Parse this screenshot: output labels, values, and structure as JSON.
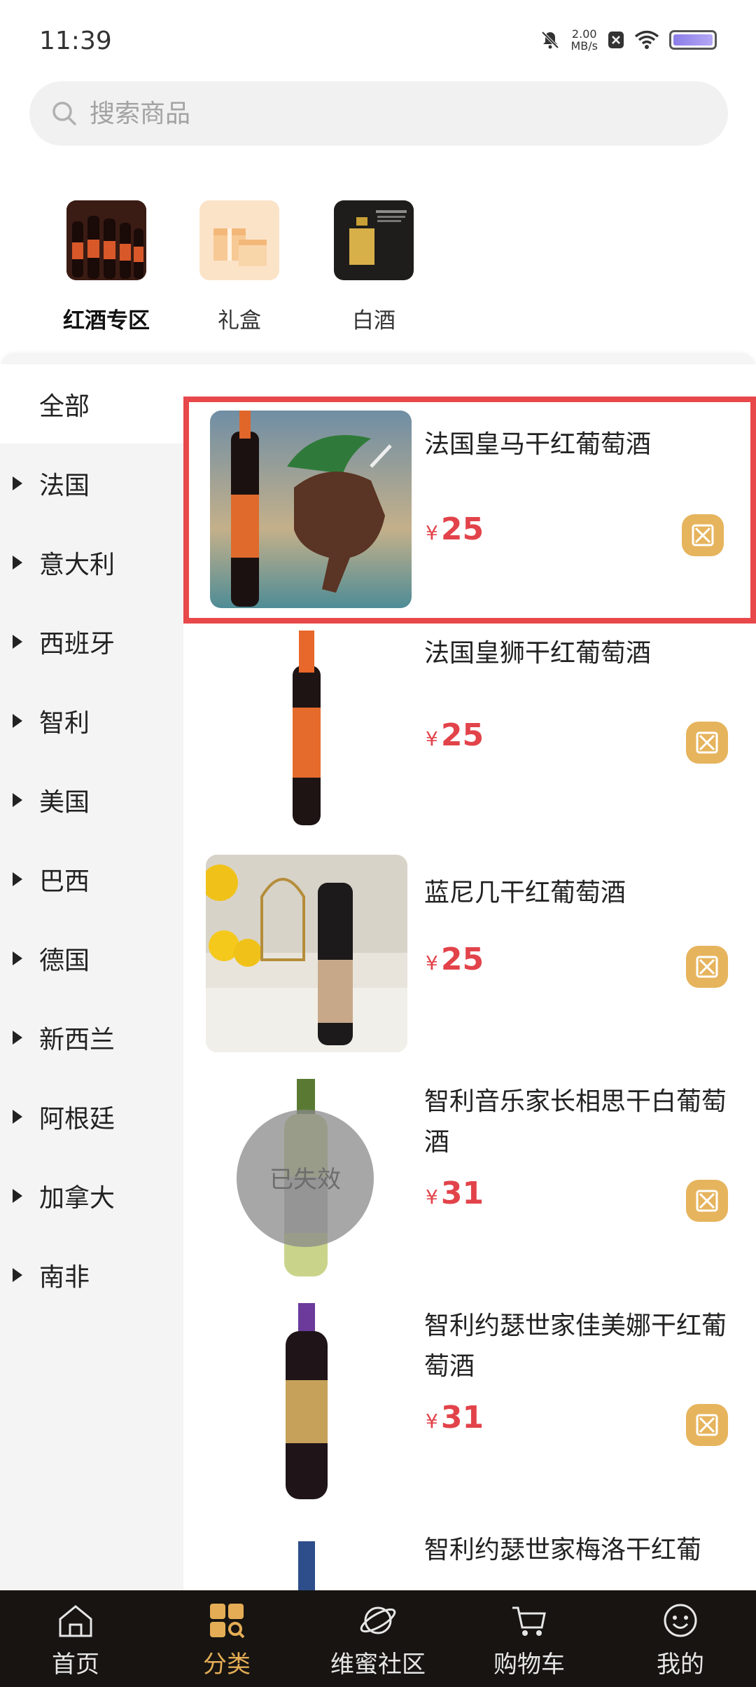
{
  "status": {
    "time": "11:39",
    "net_speed_value": "2.00",
    "net_speed_unit": "MB/s"
  },
  "search": {
    "placeholder": "搜索商品"
  },
  "top_categories": [
    {
      "label": "红酒专区",
      "active": true
    },
    {
      "label": "礼盒",
      "active": false
    },
    {
      "label": "白酒",
      "active": false
    }
  ],
  "sidebar": {
    "items": [
      {
        "label": "全部"
      },
      {
        "label": "法国"
      },
      {
        "label": "意大利"
      },
      {
        "label": "西班牙"
      },
      {
        "label": "智利"
      },
      {
        "label": "美国"
      },
      {
        "label": "巴西"
      },
      {
        "label": "德国"
      },
      {
        "label": "新西兰"
      },
      {
        "label": "阿根廷"
      },
      {
        "label": "加拿大"
      },
      {
        "label": "南非"
      }
    ]
  },
  "products": [
    {
      "name": "法国皇马干红葡萄酒",
      "currency": "¥",
      "price": "25"
    },
    {
      "name": "法国皇狮干红葡萄酒",
      "currency": "¥",
      "price": "25"
    },
    {
      "name": "蓝尼几干红葡萄酒",
      "currency": "¥",
      "price": "25"
    },
    {
      "name": "智利音乐家长相思干白葡萄酒",
      "currency": "¥",
      "price": "31",
      "overlay_text": "已失效"
    },
    {
      "name": "智利约瑟世家佳美娜干红葡萄酒",
      "currency": "¥",
      "price": "31"
    },
    {
      "name": "智利约瑟世家梅洛干红葡"
    }
  ],
  "tab_bar": {
    "tabs": [
      {
        "label": "首页"
      },
      {
        "label": "分类"
      },
      {
        "label": "维蜜社区"
      },
      {
        "label": "购物车"
      },
      {
        "label": "我的"
      }
    ]
  },
  "colors": {
    "accent_gold": "#e4ad55",
    "price_red": "#e2434a",
    "highlight_red": "#e8484a",
    "tab_bar_bg": "#171411"
  }
}
